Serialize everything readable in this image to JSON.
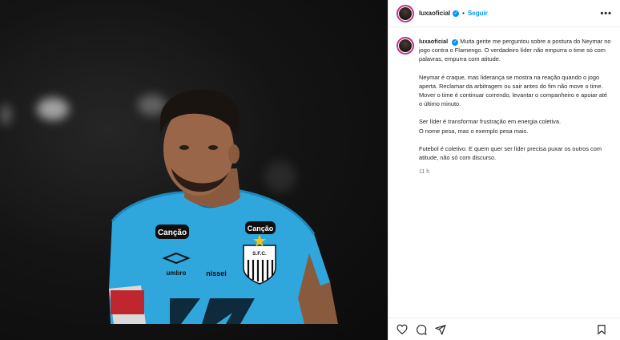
{
  "post": {
    "username": "luxaoficial",
    "verified_mark": "✓",
    "separator": "•",
    "follow_label": "Seguir",
    "more_label": "•••"
  },
  "caption": {
    "username": "luxaoficial",
    "verified_mark": "✓",
    "paragraphs": [
      "Muita gente me perguntou sobre a postura do Neymar no jogo contra o Flamengo. O verdadeiro líder não empurra o time só com palavras, empurra com atitude.",
      "Neymar é craque, mas liderança se mostra na reação quando o jogo aperta. Reclamar da arbitragem ou sair antes do fim não move o time. Mover o time é continuar correndo, levantar o companheiro e apoiar até o último minuto.",
      "Ser líder é transformar frustração em energia coletiva.",
      "O nome pesa, mas o exemplo pesa mais.",
      "Futebol é coletivo. E quem quer ser líder precisa puxar os outros com atitude, não só com discurso."
    ],
    "timestamp": "11 h"
  },
  "photo": {
    "jersey_sponsor_left": "Canção",
    "jersey_sponsor_right": "Canção",
    "jersey_brand": "umbro",
    "jersey_sponsor_center": "nissei",
    "crest_text": "S.F.C.",
    "jersey_color": "#2fa7dd"
  },
  "actions": {
    "icons": [
      "heart-icon",
      "comment-icon",
      "share-icon",
      "bookmark-icon"
    ]
  }
}
